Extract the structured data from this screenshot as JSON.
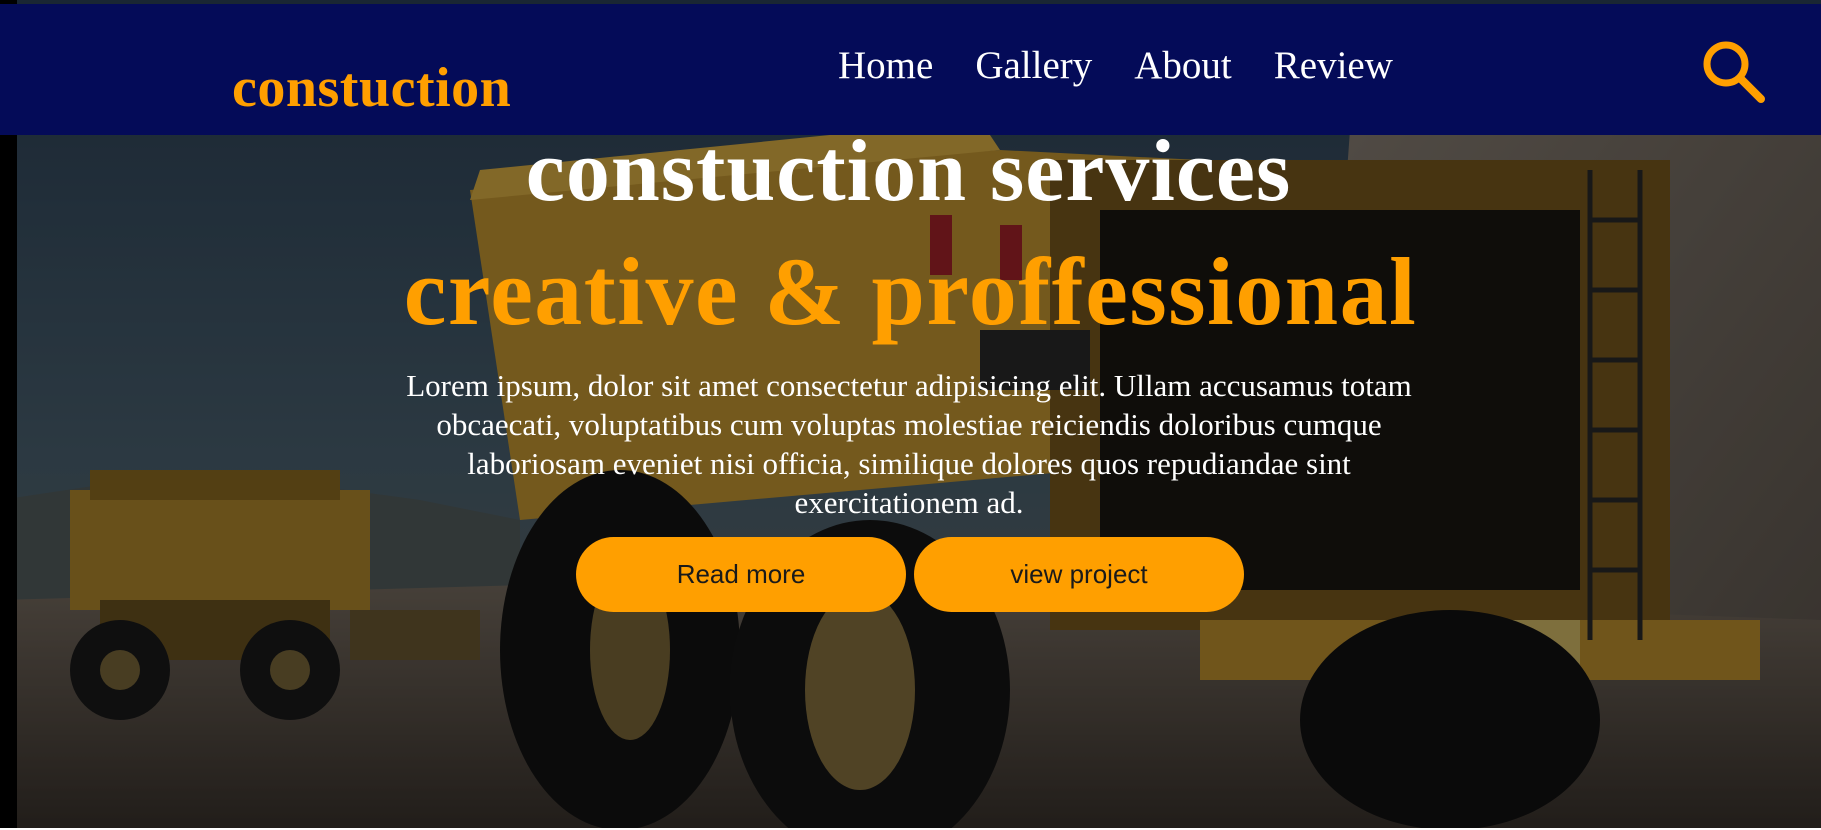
{
  "header": {
    "logo": "constuction",
    "nav": [
      "Home",
      "Gallery",
      "About",
      "Review"
    ],
    "search_icon": "search-icon"
  },
  "hero": {
    "title": "constuction services",
    "subtitle": "creative & proffessional",
    "description": "Lorem ipsum, dolor sit amet consectetur adipisicing elit. Ullam accusamus totam obcaecati, voluptatibus cum voluptas molestiae reiciendis doloribus cumque laboriosam eveniet nisi officia, similique dolores quos repudiandae sint exercitationem ad.",
    "buttons": [
      "Read more",
      "view project"
    ]
  },
  "colors": {
    "navbar": "#040b58",
    "accent": "#ff9f00",
    "text": "#ffffff"
  }
}
